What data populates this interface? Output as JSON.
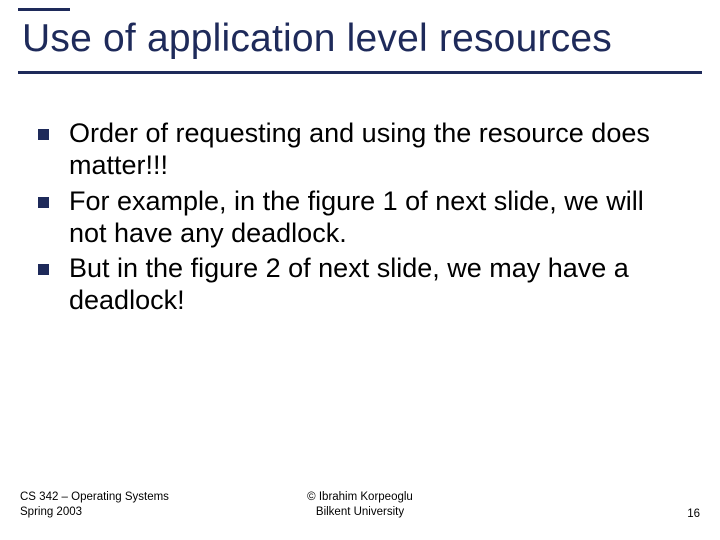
{
  "slide": {
    "title": "Use of application level resources",
    "bullets": [
      "Order of requesting and using the resource does matter!!!",
      "For example, in the figure 1 of next slide, we will not have any deadlock.",
      "But in the figure 2 of next slide, we may have a deadlock!"
    ],
    "footer": {
      "left_line1": "CS 342 – Operating Systems",
      "left_line2": "Spring 2003",
      "center_line1": "© Ibrahim Korpeoglu",
      "center_line2": "Bilkent University",
      "page_number": "16"
    }
  }
}
